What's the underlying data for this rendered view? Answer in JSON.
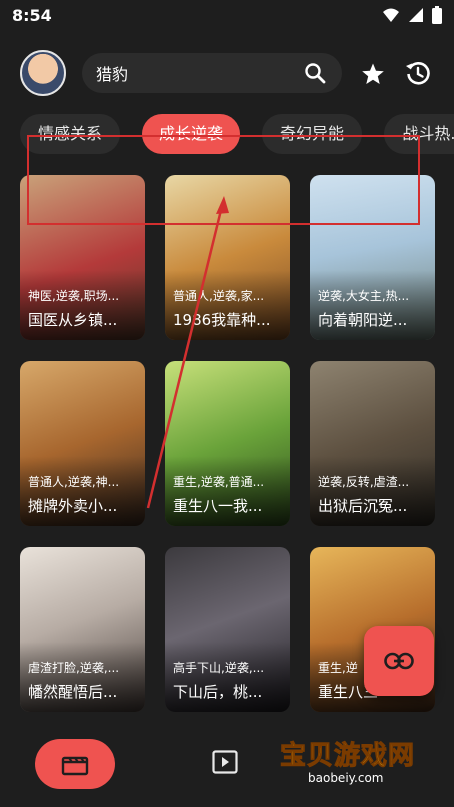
{
  "status": {
    "time": "8:54"
  },
  "search": {
    "value": "猎豹"
  },
  "tabs": [
    {
      "label": "情感关系",
      "active": false
    },
    {
      "label": "成长逆袭",
      "active": true
    },
    {
      "label": "奇幻异能",
      "active": false
    },
    {
      "label": "战斗热...",
      "active": false
    }
  ],
  "cards": [
    {
      "tags": "神医,逆袭,职场...",
      "title": "国医从乡镇..."
    },
    {
      "tags": "普通人,逆袭,家...",
      "title": "1986我靠种..."
    },
    {
      "tags": "逆袭,大女主,热...",
      "title": "向着朝阳逆..."
    },
    {
      "tags": "普通人,逆袭,神...",
      "title": "摊牌外卖小..."
    },
    {
      "tags": "重生,逆袭,普通...",
      "title": "重生八一我..."
    },
    {
      "tags": "逆袭,反转,虐渣...",
      "title": "出狱后沉冤..."
    },
    {
      "tags": "虐渣打脸,逆袭,...",
      "title": "幡然醒悟后..."
    },
    {
      "tags": "高手下山,逆袭,...",
      "title": "下山后，桃..."
    },
    {
      "tags": "重生,逆",
      "title": "重生八三"
    }
  ],
  "colors": {
    "accent": "#ef5350",
    "background": "#1e1e1e",
    "chip": "#2c2c2c"
  },
  "icons": {
    "search": "search-icon",
    "favorite": "star-icon",
    "history": "history-icon",
    "link": "link-icon",
    "drama": "clapperboard-icon",
    "video": "play-icon"
  },
  "watermark": {
    "text": "宝贝游戏网",
    "url": "baobeiy.com"
  }
}
